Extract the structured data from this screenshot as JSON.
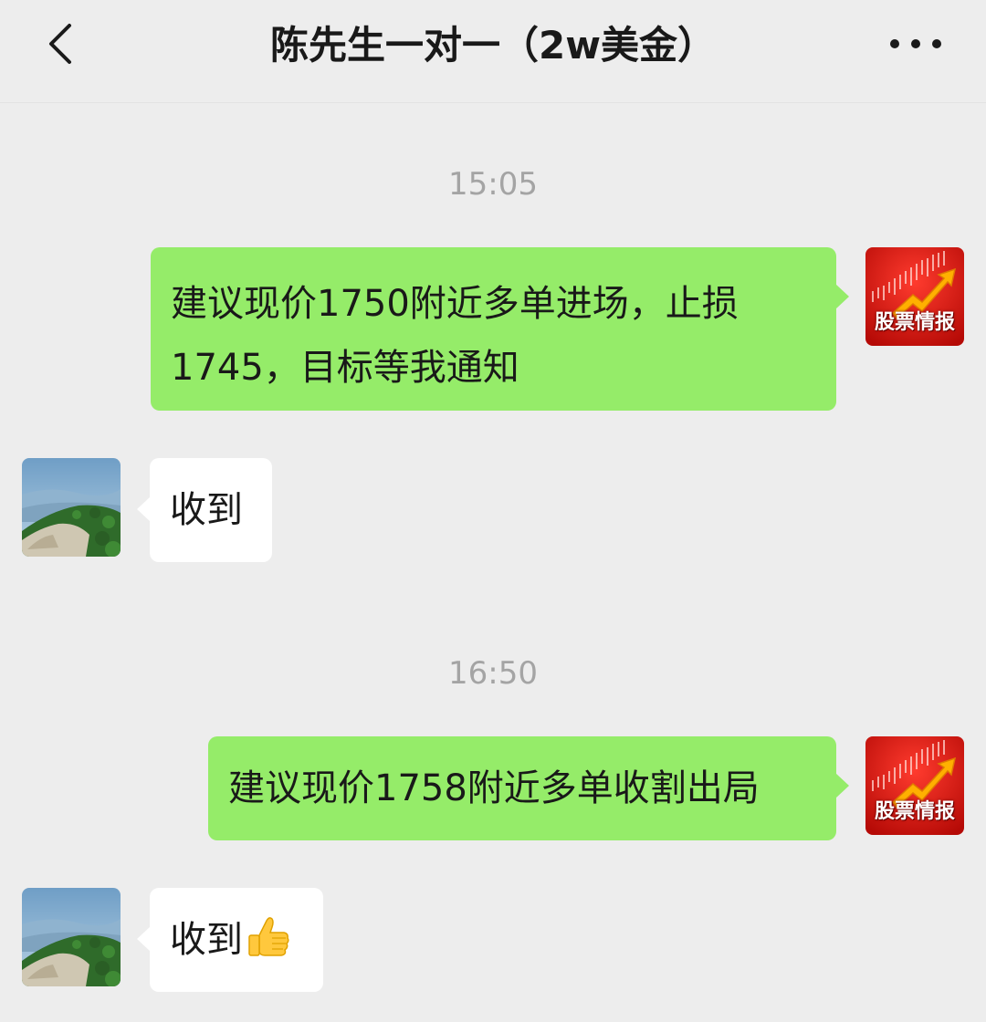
{
  "header": {
    "title": "陈先生一对一（2w美金）",
    "back_icon": "chevron-left-icon",
    "more_icon": "more-dots-icon"
  },
  "messages": [
    {
      "type": "timestamp",
      "text": "15:05"
    },
    {
      "type": "sent",
      "lines": [
        "建议现价1750附近多单进场，止损",
        "1745，目标等我通知"
      ],
      "avatar_label": "股票情报"
    },
    {
      "type": "received",
      "text": "收到"
    },
    {
      "type": "timestamp",
      "text": "16:50"
    },
    {
      "type": "sent",
      "lines": [
        "建议现价1758附近多单收割出局"
      ],
      "avatar_label": "股票情报"
    },
    {
      "type": "received",
      "text": "收到",
      "emoji": "thumbs-up-icon"
    }
  ],
  "colors": {
    "background": "#ededed",
    "sent_bubble": "#95ec69",
    "received_bubble": "#ffffff",
    "timestamp_text": "#a4a4a4",
    "avatar_red": "#d4140f"
  }
}
